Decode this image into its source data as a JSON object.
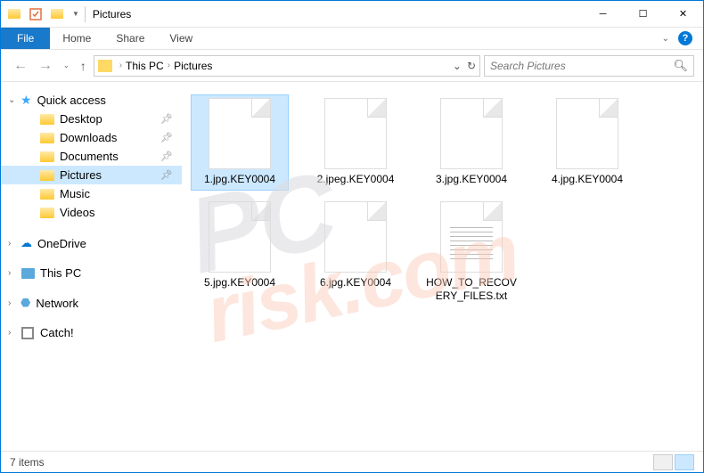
{
  "window": {
    "title": "Pictures"
  },
  "ribbon": {
    "file": "File",
    "tabs": [
      "Home",
      "Share",
      "View"
    ]
  },
  "breadcrumb": {
    "items": [
      "This PC",
      "Pictures"
    ]
  },
  "search": {
    "placeholder": "Search Pictures"
  },
  "sidebar": {
    "quick_access": {
      "label": "Quick access",
      "items": [
        {
          "label": "Desktop",
          "pinned": true
        },
        {
          "label": "Downloads",
          "pinned": true
        },
        {
          "label": "Documents",
          "pinned": true
        },
        {
          "label": "Pictures",
          "pinned": true,
          "selected": true
        },
        {
          "label": "Music",
          "pinned": false
        },
        {
          "label": "Videos",
          "pinned": false
        }
      ]
    },
    "onedrive": {
      "label": "OneDrive"
    },
    "thispc": {
      "label": "This PC"
    },
    "network": {
      "label": "Network"
    },
    "catch": {
      "label": "Catch!"
    }
  },
  "files": [
    {
      "name": "1.jpg.KEY0004",
      "type": "blank",
      "selected": true
    },
    {
      "name": "2.jpeg.KEY0004",
      "type": "blank"
    },
    {
      "name": "3.jpg.KEY0004",
      "type": "blank"
    },
    {
      "name": "4.jpg.KEY0004",
      "type": "blank"
    },
    {
      "name": "5.jpg.KEY0004",
      "type": "blank"
    },
    {
      "name": "6.jpg.KEY0004",
      "type": "blank"
    },
    {
      "name": "HOW_TO_RECOVERY_FILES.txt",
      "type": "txt"
    }
  ],
  "statusbar": {
    "count": "7 items"
  },
  "watermark": {
    "line1": "PC",
    "line2": "risk.com"
  }
}
